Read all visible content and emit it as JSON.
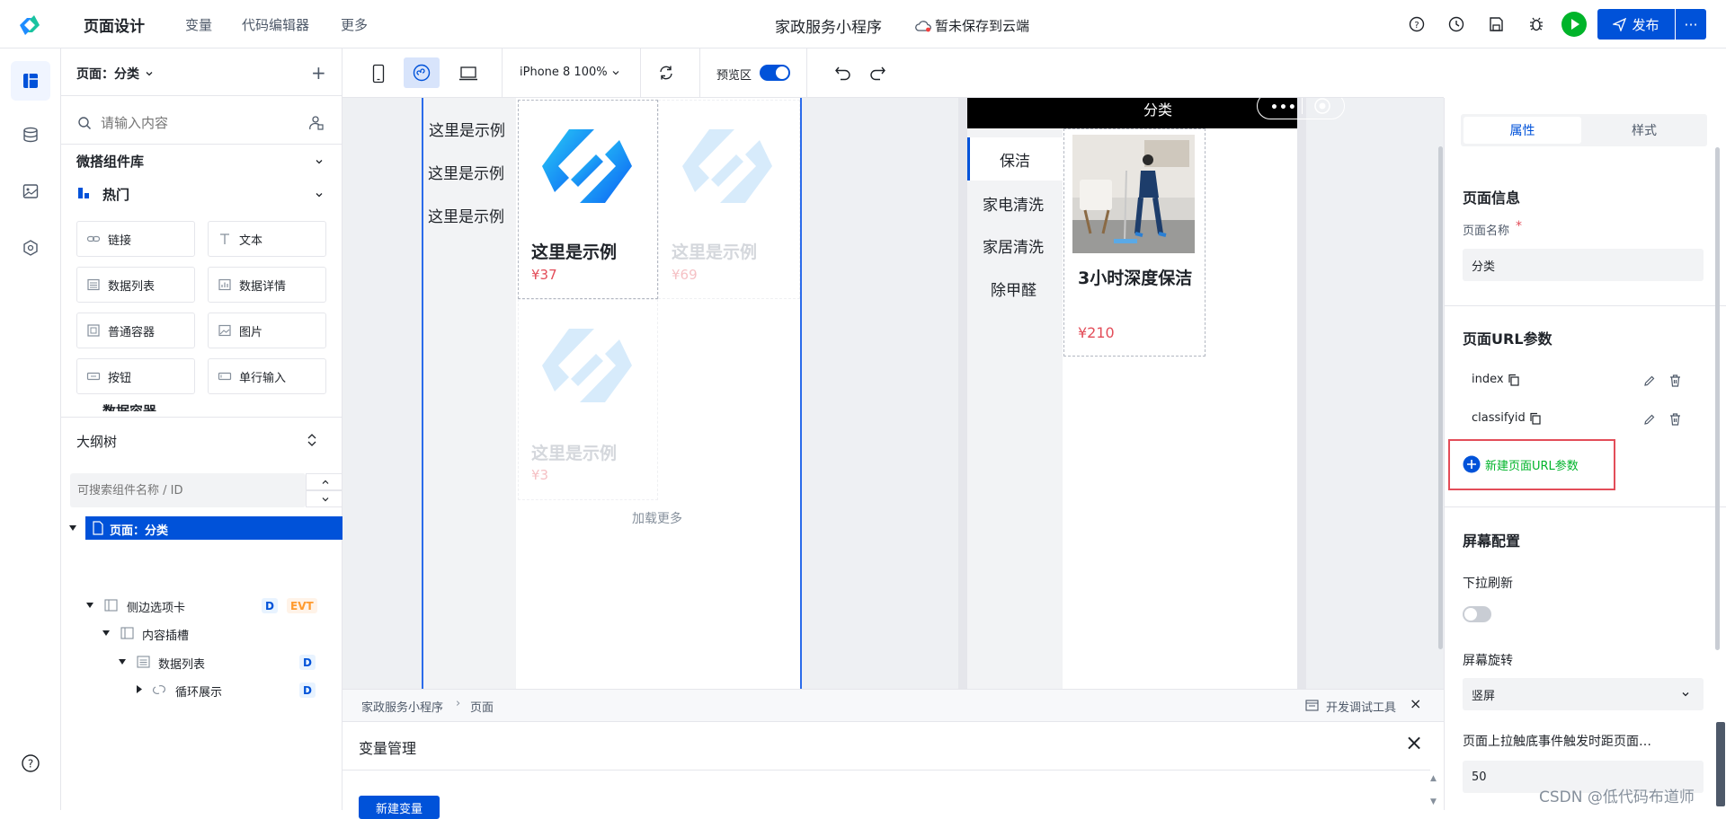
{
  "topbar": {
    "nav": [
      "页面设计",
      "变量",
      "代码编辑器",
      "更多"
    ],
    "app_title": "家政服务小程序",
    "save_status": "暂未保存到云端",
    "publish_label": "发布",
    "more_label": "···"
  },
  "left_panel": {
    "page_select": "页面：分类",
    "search_placeholder": "请输入内容",
    "library_title": "微搭组件库",
    "hot_title": "热门",
    "widgets": [
      "链接",
      "文本",
      "数据列表",
      "数据详情",
      "普通容器",
      "图片",
      "按钮",
      "单行输入"
    ],
    "next_group_partial": "数据容器",
    "outline_title": "大纲树",
    "outline_search_placeholder": "可搜索组件名称 / ID",
    "tree": [
      {
        "label": "页面：分类",
        "badges": []
      },
      {
        "label": "侧边选项卡",
        "badges": [
          "D",
          "EVT"
        ]
      },
      {
        "label": "内容插槽",
        "badges": []
      },
      {
        "label": "数据列表",
        "badges": [
          "D"
        ]
      },
      {
        "label": "循环展示",
        "badges": [
          "D"
        ]
      }
    ]
  },
  "toolbar": {
    "device": "iPhone 8 100%",
    "preview_label": "预览区",
    "preview_on": true
  },
  "design_canvas": {
    "side_tabs": [
      "这里是示例",
      "这里是示例",
      "这里是示例"
    ],
    "cards": [
      {
        "title": "这里是示例",
        "price": "¥37"
      },
      {
        "title": "这里是示例",
        "price": "¥69"
      },
      {
        "title": "这里是示例",
        "price": "¥3"
      }
    ],
    "load_more": "加载更多"
  },
  "preview": {
    "nav_title": "分类",
    "tabs": [
      "保洁",
      "家电清洗",
      "家居清洗",
      "除甲醛"
    ],
    "product": {
      "title": "3小时深度保洁",
      "price": "¥210"
    }
  },
  "right_panel": {
    "tabs": [
      "属性",
      "样式"
    ],
    "page_info_title": "页面信息",
    "page_name_label": "页面名称",
    "page_name_value": "分类",
    "url_params_title": "页面URL参数",
    "url_params": [
      "index",
      "classifyid"
    ],
    "new_param_label": "新建页面URL参数",
    "screen_title": "屏幕配置",
    "pull_refresh_label": "下拉刷新",
    "pull_refresh_on": false,
    "rotate_label": "屏幕旋转",
    "rotate_value": "竖屏",
    "reach_bottom_label": "页面上拉触底事件触发时距页面…",
    "reach_bottom_value": "50"
  },
  "bottom": {
    "breadcrumb": [
      "家政服务小程序",
      "页面"
    ],
    "devtools_label": "开发调试工具",
    "variable_title": "变量管理",
    "new_variable_label": "新建变量"
  },
  "watermark": "CSDN @低代码布道师",
  "colors": {
    "primary": "#0052d9",
    "price": "#e34d59",
    "green": "#00b42a",
    "highlight_box": "#e34d59"
  }
}
